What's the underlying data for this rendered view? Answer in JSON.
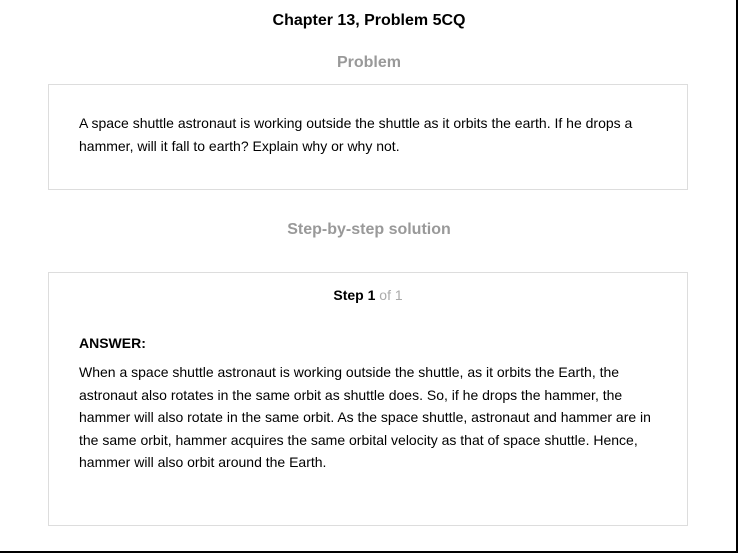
{
  "page": {
    "title": "Chapter 13, Problem 5CQ"
  },
  "problem": {
    "heading": "Problem",
    "text": "A space shuttle astronaut is working outside the shuttle as it orbits the earth. If he drops a hammer, will it fall to earth? Explain why or why not."
  },
  "solution": {
    "heading": "Step-by-step solution",
    "step": {
      "word": "Step",
      "number": "1",
      "of_text": "of 1"
    },
    "answer_label": "ANSWER:",
    "answer_text": "When a space shuttle astronaut is working outside the shuttle, as it orbits the Earth, the astronaut also rotates in the same orbit as shuttle does. So, if he drops the hammer, the hammer will also rotate in the same orbit. As the space shuttle, astronaut and hammer are in the same orbit, hammer acquires the same orbital velocity as that of space shuttle. Hence, hammer will also orbit around the Earth."
  },
  "colors": {
    "heading_gray": "#999999",
    "step_of_gray": "#aaaaaa",
    "card_border": "#dddddd",
    "frame": "#000000"
  }
}
